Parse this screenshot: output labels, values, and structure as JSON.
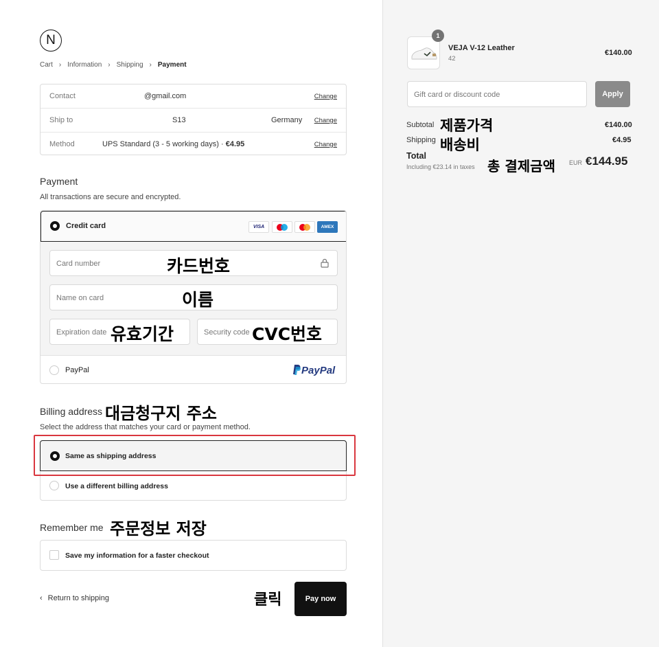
{
  "logo": {
    "letter": "N"
  },
  "breadcrumb": [
    "Cart",
    "Information",
    "Shipping",
    "Payment"
  ],
  "info": {
    "contact": {
      "label": "Contact",
      "value": "@gmail.com",
      "change": "Change"
    },
    "ship_to": {
      "label": "Ship to",
      "value": "S13",
      "value2": "Germany",
      "change": "Change"
    },
    "method": {
      "label": "Method",
      "value": "UPS Standard (3 - 5 working days) · ",
      "price": "€4.95",
      "change": "Change"
    }
  },
  "payment": {
    "title": "Payment",
    "subtitle": "All transactions are secure and encrypted.",
    "credit_card_label": "Credit card",
    "card_brands": [
      "VISA",
      "",
      "",
      "AMEX"
    ],
    "fields": {
      "card_number": "Card number",
      "name_on_card": "Name on card",
      "expiration": "Expiration date",
      "security_code": "Security code"
    },
    "paypal_label": "PayPal",
    "paypal_logo": "PayPal"
  },
  "billing": {
    "title": "Billing address",
    "subtitle": "Select the address that matches your card or payment method.",
    "options": [
      "Same as shipping address",
      "Use a different billing address"
    ]
  },
  "remember": {
    "title": "Remember me",
    "checkbox_label": "Save my information for a faster checkout"
  },
  "footer": {
    "return_label": "Return to shipping",
    "pay_button": "Pay now"
  },
  "annotations": {
    "card_number": "카드번호",
    "name": "이름",
    "expiry": "유효기간",
    "cvc": "CVC번호",
    "billing": "대금청구지 주소",
    "remember": "주문정보 저장",
    "click": "클릭",
    "product_price": "제품가격",
    "shipping_fee": "배송비",
    "total": "총 결제금액"
  },
  "summary": {
    "product_name": "VEJA V-12 Leather",
    "product_variant": "42",
    "product_price": "€140.00",
    "quantity": "1",
    "gift_placeholder": "Gift card or discount code",
    "apply_label": "Apply",
    "subtotal_label": "Subtotal",
    "subtotal_value": "€140.00",
    "shipping_label": "Shipping",
    "shipping_value": "€4.95",
    "total_label": "Total",
    "taxes_note": "Including €23.14 in taxes",
    "currency": "EUR",
    "total_value": "€144.95"
  },
  "colors": {
    "highlight": "#d9363e",
    "button_dark": "#111111",
    "apply_button": "#8a8a8a",
    "amex": "#2e77bb",
    "paypal_dark": "#253b80",
    "paypal_light": "#179bd7"
  }
}
